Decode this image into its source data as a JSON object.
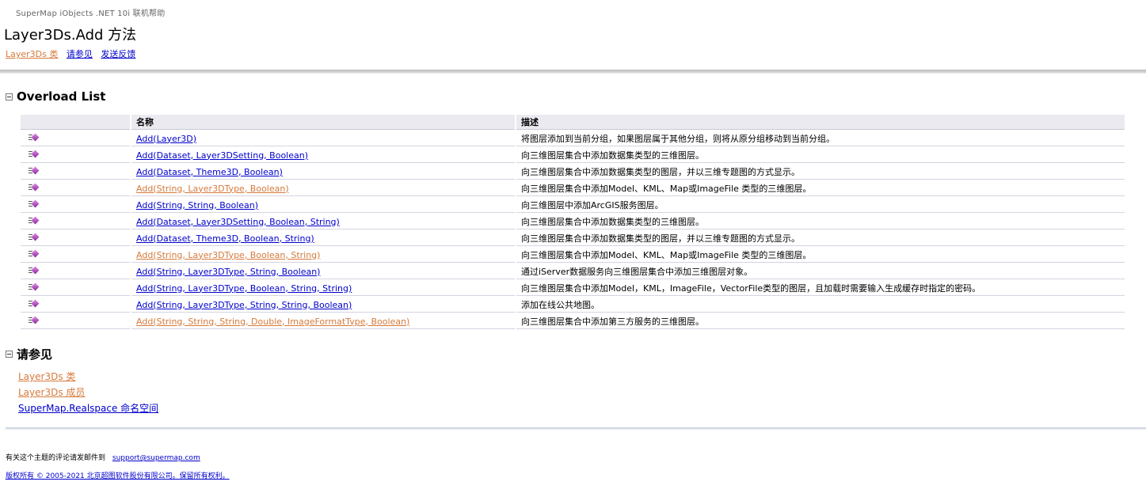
{
  "header": {
    "product": "SuperMap iObjects .NET 10i 联机帮助",
    "title": "Layer3Ds.Add 方法",
    "links": [
      "Layer3Ds 类",
      "请参见",
      "发送反馈"
    ]
  },
  "overload": {
    "section_title": "Overload List",
    "columns": [
      "名称",
      "描述"
    ],
    "rows": [
      {
        "name": "Add(Layer3D)",
        "desc": "将图层添加到当前分组，如果图层属于其他分组，则将从原分组移动到当前分组。",
        "style": "blue"
      },
      {
        "name": "Add(Dataset, Layer3DSetting, Boolean)",
        "desc": "向三维图层集合中添加数据集类型的三维图层。",
        "style": "blue"
      },
      {
        "name": "Add(Dataset, Theme3D, Boolean)",
        "desc": "向三维图层集合中添加数据集类型的图层，并以三维专题图的方式显示。",
        "style": "blue"
      },
      {
        "name": "Add(String, Layer3DType, Boolean)",
        "desc": "向三维图层集合中添加Model、KML、Map或ImageFile 类型的三维图层。",
        "style": "orange"
      },
      {
        "name": "Add(String, String, Boolean)",
        "desc": "向三维图层中添加ArcGIS服务图层。",
        "style": "blue"
      },
      {
        "name": "Add(Dataset, Layer3DSetting, Boolean, String)",
        "desc": "向三维图层集合中添加数据集类型的三维图层。",
        "style": "blue"
      },
      {
        "name": "Add(Dataset, Theme3D, Boolean, String)",
        "desc": "向三维图层集合中添加数据集类型的图层，并以三维专题图的方式显示。",
        "style": "blue"
      },
      {
        "name": "Add(String, Layer3DType, Boolean, String)",
        "desc": "向三维图层集合中添加Model、KML、Map或ImageFile 类型的三维图层。",
        "style": "orange"
      },
      {
        "name": "Add(String, Layer3DType, String, Boolean)",
        "desc": "通过iServer数据服务向三维图层集合中添加三维图层对象。",
        "style": "blue"
      },
      {
        "name": "Add(String, Layer3DType, Boolean, String, String)",
        "desc": "向三维图层集合中添加Model，KML，ImageFile，VectorFile类型的图层，且加载时需要输入生成缓存时指定的密码。",
        "style": "blue"
      },
      {
        "name": "Add(String, Layer3DType, String, String, Boolean)",
        "desc": "添加在线公共地图。",
        "style": "blue"
      },
      {
        "name": "Add(String, String, String, Double, ImageFormatType, Boolean)",
        "desc": "向三维图层集合中添加第三方服务的三维图层。",
        "style": "orange"
      }
    ]
  },
  "see_also": {
    "section_title": "请参见",
    "links": [
      {
        "label": "Layer3Ds 类",
        "style": "orange"
      },
      {
        "label": "Layer3Ds 成员",
        "style": "orange"
      },
      {
        "label": "SuperMap.Realspace 命名空间",
        "style": "blue"
      }
    ]
  },
  "footer": {
    "feedback_text": "有关这个主题的评论请发邮件到",
    "email": "support@supermap.com",
    "copyright": "版权所有 © 2005-2021 北京超图软件股份有限公司。保留所有权利。"
  },
  "colors": {
    "link_blue": "#0000cc",
    "link_visited_orange": "#d57a3b",
    "table_header_bg": "#eaeaf0"
  },
  "icons": {
    "method_icon": "public-method-icon",
    "collapse_icon": "collapse-minus-icon"
  }
}
